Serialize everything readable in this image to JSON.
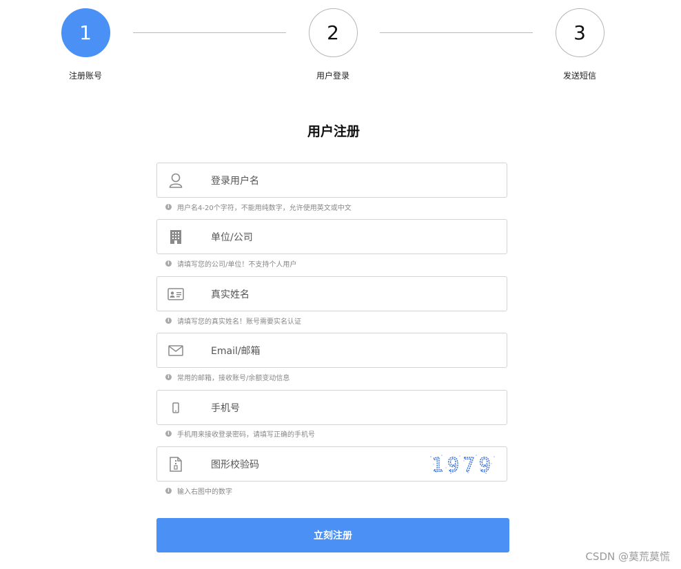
{
  "steps": [
    {
      "number": "1",
      "label": "注册账号",
      "active": true
    },
    {
      "number": "2",
      "label": "用户登录",
      "active": false
    },
    {
      "number": "3",
      "label": "发送短信",
      "active": false
    }
  ],
  "title": "用户注册",
  "form": {
    "username": {
      "placeholder": "登录用户名",
      "hint": "用户名4-20个字符，不能用纯数字，允许使用英文或中文",
      "icon": "user-icon"
    },
    "company": {
      "placeholder": "单位/公司",
      "hint": "请填写您的公司/单位！不支持个人用户",
      "icon": "building-icon"
    },
    "realname": {
      "placeholder": "真实姓名",
      "hint": "请填写您的真实姓名！账号需要实名认证",
      "icon": "id-card-icon"
    },
    "email": {
      "placeholder": "Email/邮箱",
      "hint": "常用的邮箱，接收账号/余额变动信息",
      "icon": "mail-icon"
    },
    "phone": {
      "placeholder": "手机号",
      "hint": "手机用来接收登录密码，请填写正确的手机号",
      "icon": "mobile-icon"
    },
    "captcha": {
      "placeholder": "图形校验码",
      "hint": "输入右图中的数字",
      "icon": "document-icon",
      "image_text": "1979"
    }
  },
  "submit_label": "立刻注册",
  "watermark": "CSDN @莫荒莫慌",
  "colors": {
    "accent": "#4a90f5",
    "border": "#d3d3d3",
    "hint": "#888888"
  }
}
